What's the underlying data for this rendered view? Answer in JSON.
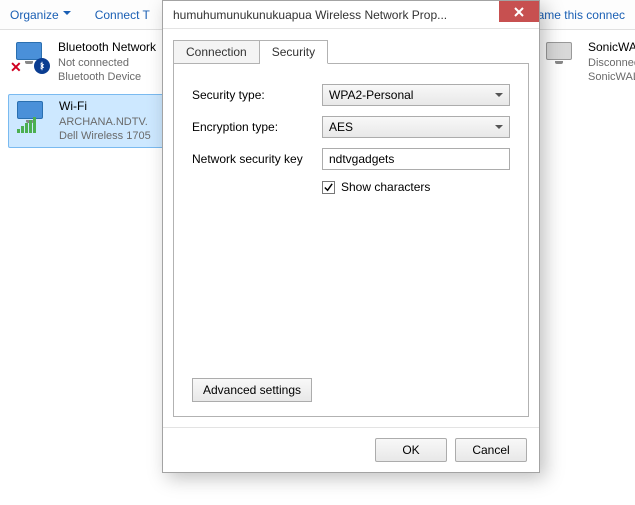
{
  "toolbar": {
    "organize": "Organize",
    "connect": "Connect T",
    "rename": "hame this connec"
  },
  "networks": {
    "left": [
      {
        "name": "Bluetooth Network",
        "line2": "Not connected",
        "line3": "Bluetooth Device"
      },
      {
        "name": "Wi-Fi",
        "line2": "ARCHANA.NDTV.",
        "line3": "Dell Wireless 1705"
      }
    ],
    "right": [
      {
        "name": "SonicWALL I",
        "line2": "Disconnecte",
        "line3": "SonicWALL I"
      }
    ]
  },
  "dialog": {
    "title": "humuhumunukunukuapua Wireless Network Prop...",
    "tabs": {
      "connection": "Connection",
      "security": "Security"
    },
    "security_type_label": "Security type:",
    "security_type_value": "WPA2-Personal",
    "encryption_type_label": "Encryption type:",
    "encryption_type_value": "AES",
    "network_key_label": "Network security key",
    "network_key_value": "ndtvgadgets",
    "show_characters_label": "Show characters",
    "show_characters_checked": true,
    "advanced_settings": "Advanced settings",
    "ok": "OK",
    "cancel": "Cancel"
  }
}
